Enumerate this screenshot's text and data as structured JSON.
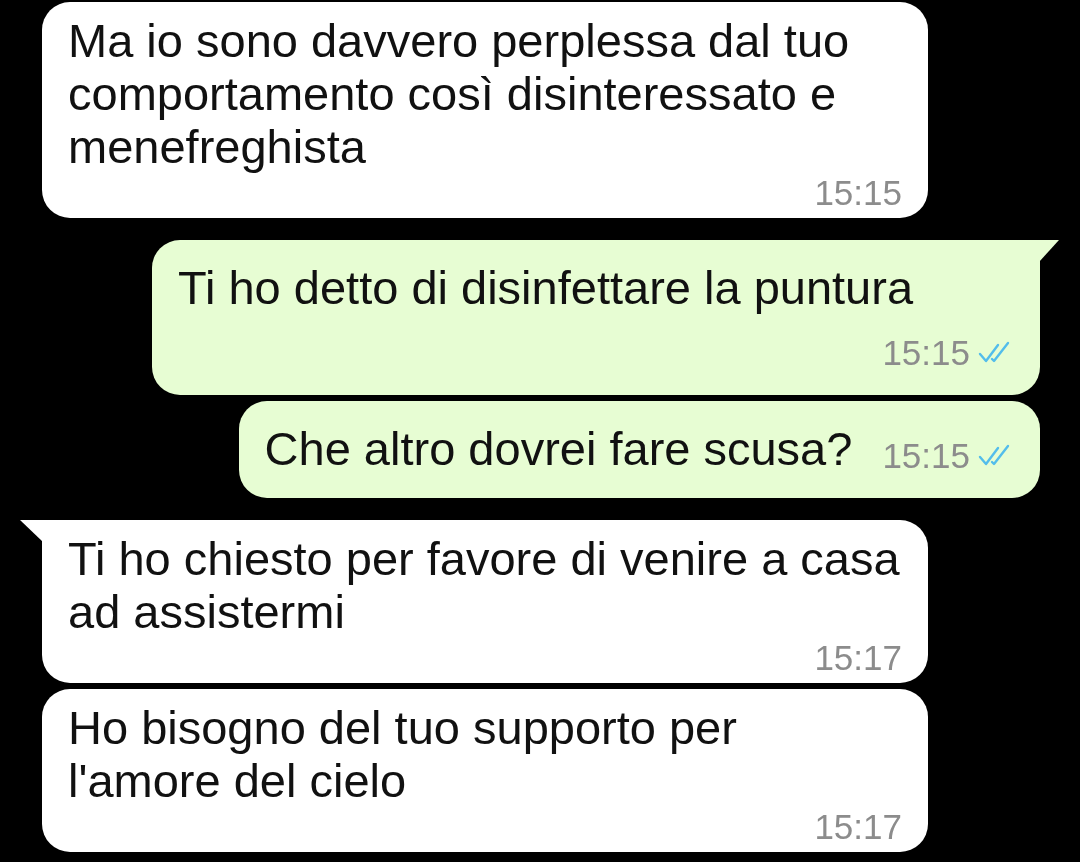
{
  "messages": [
    {
      "kind": "incoming",
      "tail": false,
      "text": "Ma io sono davvero perplessa dal tuo comportamento così disinteressato e menefreghista",
      "time": "15:15"
    },
    {
      "kind": "outgoing",
      "tail": true,
      "text": "Ti ho detto di disinfettare la puntura",
      "time": "15:15",
      "read": true
    },
    {
      "kind": "outgoing",
      "tail": false,
      "text": "Che altro dovrei fare scusa?",
      "time": "15:15",
      "read": true
    },
    {
      "kind": "incoming",
      "tail": true,
      "text": "Ti ho chiesto per favore di venire a casa ad assistermi",
      "time": "15:17"
    },
    {
      "kind": "incoming",
      "tail": false,
      "text": "Ho bisogno del tuo supporto per l'amore del cielo",
      "time": "15:17"
    }
  ]
}
